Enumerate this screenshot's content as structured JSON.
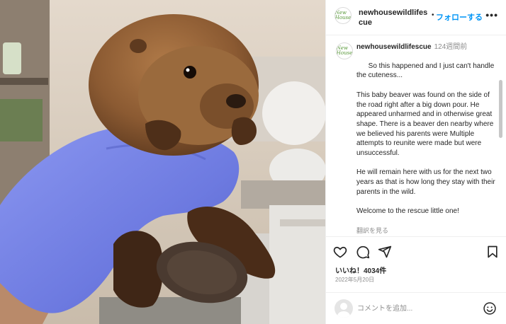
{
  "post": {
    "username": "newhousewildlifescue",
    "follow_label": "フォローする",
    "follow_separator": "•",
    "more_label": "•••",
    "avatar_text": "New House",
    "caption": {
      "username": "newhousewildlifescue",
      "time_ago": "124週間前",
      "text": "So this happened and I just can't handle the cuteness...\n\nThis baby beaver was found on the side of the road right after a big down pour. He appeared unharmed and in otherwise great shape. There is a beaver den nearby where we believed his parents were Multiple attempts to reunite were made but were unsuccessful.\n\nHe will remain here with us for the next two years as that is how long they stay with their parents in the wild.\n\nWelcome to the rescue little one!",
      "translate_label": "翻訳を見る"
    },
    "actions": {
      "like_icon": "heart-icon",
      "comment_icon": "comment-icon",
      "share_icon": "send-icon",
      "save_icon": "bookmark-icon"
    },
    "likes_text": "いいね！4034件",
    "date_text": "2022年5月20日",
    "comment_placeholder": "コメントを追加...",
    "colors": {
      "link_blue": "#0095f6",
      "glove_blue": "#7a86e8",
      "beaver_brown": "#8b5a32"
    }
  }
}
